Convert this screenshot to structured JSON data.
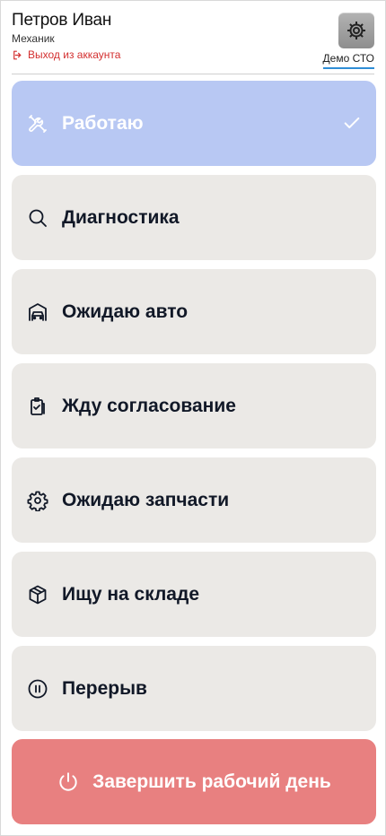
{
  "header": {
    "user_name": "Петров Иван",
    "user_role": "Механик",
    "logout_label": "Выход из аккаунта",
    "company_name": "Демо СТО",
    "settings_icon": "gear-icon"
  },
  "statuses": [
    {
      "label": "Работаю",
      "icon": "tools-icon",
      "active": true
    },
    {
      "label": "Диагностика",
      "icon": "search-icon",
      "active": false
    },
    {
      "label": "Ожидаю авто",
      "icon": "garage-car-icon",
      "active": false
    },
    {
      "label": "Жду согласование",
      "icon": "clipboard-check-icon",
      "active": false
    },
    {
      "label": "Ожидаю запчасти",
      "icon": "gear-icon",
      "active": false
    },
    {
      "label": "Ищу на складе",
      "icon": "box-icon",
      "active": false
    },
    {
      "label": "Перерыв",
      "icon": "pause-icon",
      "active": false
    }
  ],
  "end_day": {
    "label": "Завершить рабочий день",
    "icon": "power-icon"
  },
  "colors": {
    "active_status": "#b8c8f3",
    "inactive_status": "#ebe9e6",
    "end_day": "#e88080",
    "logout": "#d32f2f",
    "company_underline": "#2f8ed6"
  }
}
